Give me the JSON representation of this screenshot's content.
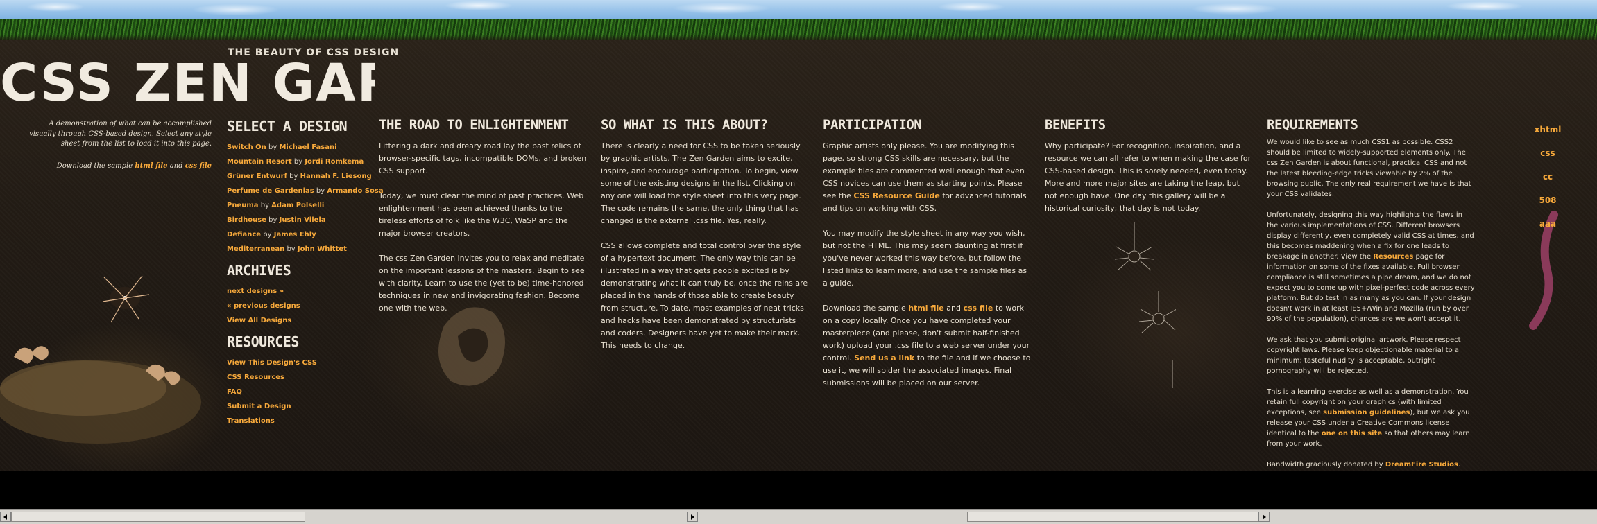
{
  "header": {
    "title": "CSS ZEN GARDEN",
    "tagline": "THE BEAUTY OF CSS DESIGN"
  },
  "intro": {
    "summary": "A demonstration of what can be accomplished visually through CSS-based design. Select any style sheet from the list to load it into this page.",
    "download_prefix": "Download the sample",
    "html_file": "html file",
    "and": "and",
    "css_file": "css file"
  },
  "sidebar": {
    "select_heading": "SELECT A DESIGN",
    "designs": [
      {
        "title": "Switch On",
        "by": "by",
        "author": "Michael Fasani"
      },
      {
        "title": "Mountain Resort",
        "by": "by",
        "author": "Jordi Romkema"
      },
      {
        "title": "Grüner Entwurf",
        "by": "by",
        "author": "Hannah F. Liesong"
      },
      {
        "title": "Perfume de Gardenias",
        "by": "by",
        "author": "Armando Sosa"
      },
      {
        "title": "Pneuma",
        "by": "by",
        "author": "Adam Polselli"
      },
      {
        "title": "Birdhouse",
        "by": "by",
        "author": "Justin Vilela"
      },
      {
        "title": "Defiance",
        "by": "by",
        "author": "James Ehly"
      },
      {
        "title": "Mediterranean",
        "by": "by",
        "author": "John Whittet"
      }
    ],
    "archives_heading": "ARCHIVES",
    "archives": [
      "next designs »",
      "« previous designs",
      "View All Designs"
    ],
    "resources_heading": "RESOURCES",
    "resources": [
      "View This Design's CSS",
      "CSS Resources",
      "FAQ",
      "Submit a Design",
      "Translations"
    ]
  },
  "columns": {
    "road": {
      "heading": "THE ROAD TO ENLIGHTENMENT",
      "p1": "Littering a dark and dreary road lay the past relics of browser-specific tags, incompatible DOMs, and broken CSS support.",
      "p2": "Today, we must clear the mind of past practices. Web enlightenment has been achieved thanks to the tireless efforts of folk like the W3C, WaSP and the major browser creators.",
      "p3": "The css Zen Garden invites you to relax and meditate on the important lessons of the masters. Begin to see with clarity. Learn to use the (yet to be) time-honored techniques in new and invigorating fashion. Become one with the web."
    },
    "about": {
      "heading": "SO WHAT IS THIS ABOUT?",
      "p1": "There is clearly a need for CSS to be taken seriously by graphic artists. The Zen Garden aims to excite, inspire, and encourage participation. To begin, view some of the existing designs in the list. Clicking on any one will load the style sheet into this very page. The code remains the same, the only thing that has changed is the external .css file. Yes, really.",
      "p2": "CSS allows complete and total control over the style of a hypertext document. The only way this can be illustrated in a way that gets people excited is by demonstrating what it can truly be, once the reins are placed in the hands of those able to create beauty from structure. To date, most examples of neat tricks and hacks have been demonstrated by structurists and coders. Designers have yet to make their mark. This needs to change."
    },
    "participation": {
      "heading": "PARTICIPATION",
      "p1_a": "Graphic artists only please. You are modifying this page, so strong CSS skills are necessary, but the example files are commented well enough that even CSS novices can use them as starting points. Please see the",
      "p1_link": "CSS Resource Guide",
      "p1_b": "for advanced tutorials and tips on working with CSS.",
      "p2": "You may modify the style sheet in any way you wish, but not the HTML. This may seem daunting at first if you've never worked this way before, but follow the listed links to learn more, and use the sample files as a guide.",
      "p3_a": "Download the sample",
      "p3_html": "html file",
      "p3_and": "and",
      "p3_css": "css file",
      "p3_b": "to work on a copy locally. Once you have completed your masterpiece (and please, don't submit half-finished work) upload your .css file to a web server under your control.",
      "p3_send": "Send us a link",
      "p3_c": "to the file and if we choose to use it, we will spider the associated images. Final submissions will be placed on our server."
    },
    "benefits": {
      "heading": "BENEFITS",
      "p1": "Why participate? For recognition, inspiration, and a resource we can all refer to when making the case for CSS-based design. This is sorely needed, even today. More and more major sites are taking the leap, but not enough have. One day this gallery will be a historical curiosity; that day is not today."
    },
    "requirements": {
      "heading": "REQUIREMENTS",
      "p1": "We would like to see as much CSS1 as possible. CSS2 should be limited to widely-supported elements only. The css Zen Garden is about functional, practical CSS and not the latest bleeding-edge tricks viewable by 2% of the browsing public. The only real requirement we have is that your CSS validates.",
      "p2_a": "Unfortunately, designing this way highlights the flaws in the various implementations of CSS. Different browsers display differently, even completely valid CSS at times, and this becomes maddening when a fix for one leads to breakage in another. View the",
      "p2_link": "Resources",
      "p2_b": "page for information on some of the fixes available. Full browser compliance is still sometimes a pipe dream, and we do not expect you to come up with pixel-perfect code across every platform. But do test in as many as you can. If your design doesn't work in at least IE5+/Win and Mozilla (run by over 90% of the population), chances are we won't accept it.",
      "p3": "We ask that you submit original artwork. Please respect copyright laws. Please keep objectionable material to a minimum; tasteful nudity is acceptable, outright pornography will be rejected.",
      "p4_a": "This is a learning exercise as well as a demonstration. You retain full copyright on your graphics (with limited exceptions, see",
      "p4_link1": "submission guidelines",
      "p4_b": "), but we ask you release your CSS under a Creative Commons license identical to the",
      "p4_link2": "one on this site",
      "p4_c": "so that others may learn from your work.",
      "p5_a": "Bandwidth graciously donated by",
      "p5_link": "DreamFire Studios",
      "p5_b": "."
    }
  },
  "rightnav": [
    "xhtml",
    "css",
    "cc",
    "508",
    "aaa"
  ],
  "colors": {
    "accent": "#f7a93b",
    "text": "#e9e1d2",
    "background": "#231c15"
  }
}
